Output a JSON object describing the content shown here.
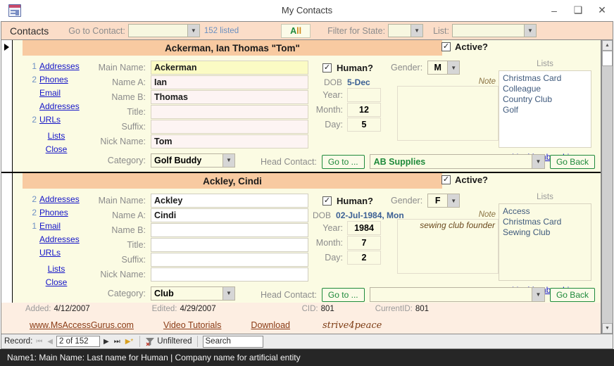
{
  "window": {
    "title": "My Contacts",
    "icon": "access-form-icon",
    "minimize": "–",
    "maximize": "❑",
    "close": "✕"
  },
  "toolbar": {
    "caption": "Contacts",
    "goto_label": "Go to Contact:",
    "goto_value": "",
    "count_listed": "152 listed",
    "all_button": {
      "a": "A",
      "l1": "l",
      "l2": "l"
    },
    "filter_state_label": "Filter for State:",
    "filter_state_value": "",
    "list_label": "List:",
    "list_value": ""
  },
  "records": [
    {
      "selected": true,
      "title": "Ackerman, Ian Thomas \"Tom\"",
      "active_label": "Active?",
      "active_checked": "✓",
      "links": [
        {
          "num": "1",
          "text": "Addresses"
        },
        {
          "num": "2",
          "text": "Phones"
        },
        {
          "num": "",
          "text": "Email"
        },
        {
          "num": "",
          "text": "Addresses"
        },
        {
          "num": "2",
          "text": "URLs"
        },
        {
          "num": "",
          "text": "Lists"
        },
        {
          "num": "",
          "text": "Close"
        }
      ],
      "fields": [
        {
          "label": "Main Name:",
          "value": "Ackerman",
          "style": "focused"
        },
        {
          "label": "Name A:",
          "value": "Ian",
          "style": "tinted"
        },
        {
          "label": "Name B:",
          "value": "Thomas",
          "style": "tinted"
        },
        {
          "label": "Title:",
          "value": "",
          "style": "tinted"
        },
        {
          "label": "Suffix:",
          "value": "",
          "style": "tinted"
        },
        {
          "label": "Nick Name:",
          "value": "Tom",
          "style": "tinted"
        }
      ],
      "category_label": "Category:",
      "category_value": "Golf Buddy",
      "human_label": "Human?",
      "human_checked": "✓",
      "gender_label": "Gender:",
      "gender_value": "M",
      "dob_label": "DOB",
      "dob_value": "5-Dec",
      "dob_year_label": "Year:",
      "dob_year": "",
      "dob_month_label": "Month:",
      "dob_month": "12",
      "dob_day_label": "Day:",
      "dob_day": "5",
      "note_label": "Note",
      "note_value": "",
      "lists_label": "Lists",
      "lists": "Christmas Card\nColleague\nCountry Club\nGolf",
      "list_memberships": "List Memberships",
      "head_contact_label": "Head Contact:",
      "goto_button": "Go to ...",
      "head_contact_value": "AB Supplies",
      "go_back_button": "Go Back"
    },
    {
      "selected": false,
      "title": "Ackley, Cindi",
      "active_label": "Active?",
      "active_checked": "✓",
      "links": [
        {
          "num": "2",
          "text": "Addresses"
        },
        {
          "num": "2",
          "text": "Phones"
        },
        {
          "num": "1",
          "text": "Email"
        },
        {
          "num": "",
          "text": "Addresses"
        },
        {
          "num": "",
          "text": "URLs"
        },
        {
          "num": "",
          "text": "Lists"
        },
        {
          "num": "",
          "text": "Close"
        }
      ],
      "fields": [
        {
          "label": "Main Name:",
          "value": "Ackley",
          "style": "plain"
        },
        {
          "label": "Name A:",
          "value": "Cindi",
          "style": "plain"
        },
        {
          "label": "Name B:",
          "value": "",
          "style": "plain"
        },
        {
          "label": "Title:",
          "value": "",
          "style": "plain"
        },
        {
          "label": "Suffix:",
          "value": "",
          "style": "plain"
        },
        {
          "label": "Nick Name:",
          "value": "",
          "style": "plain"
        }
      ],
      "category_label": "Category:",
      "category_value": "Club",
      "human_label": "Human?",
      "human_checked": "✓",
      "gender_label": "Gender:",
      "gender_value": "F",
      "dob_label": "DOB",
      "dob_value": "02-Jul-1984, Mon",
      "dob_year_label": "Year:",
      "dob_year": "1984",
      "dob_month_label": "Month:",
      "dob_month": "7",
      "dob_day_label": "Day:",
      "dob_day": "2",
      "note_label": "Note",
      "note_value": "sewing club founder",
      "lists_label": "Lists",
      "lists": "Access\nChristmas Card\nSewing Club",
      "list_memberships": "List Memberships",
      "head_contact_label": "Head Contact:",
      "goto_button": "Go to ...",
      "head_contact_value": "",
      "go_back_button": "Go Back"
    }
  ],
  "footer": {
    "added_label": "Added:",
    "added_value": "4/12/2007",
    "edited_label": "Edited:",
    "edited_value": "4/29/2007",
    "cid_label": "CID:",
    "cid_value": "801",
    "currentid_label": "CurrentID:",
    "currentid_value": "801",
    "link_site": "www.MsAccessGurus.com",
    "link_videos": "Video Tutorials",
    "link_download": "Download",
    "signature": "strive4peace"
  },
  "navbar": {
    "record_label": "Record:",
    "first": "⏮",
    "prev": "◀",
    "position": "2 of 152",
    "next": "▶",
    "last": "⏭",
    "new": "▶*",
    "filter_status": "Unfiltered",
    "search_placeholder": "Search",
    "search_value": "Search"
  },
  "statusbar": {
    "text": "Name1: Main Name: Last name for Human | Company name for artificial entity"
  }
}
